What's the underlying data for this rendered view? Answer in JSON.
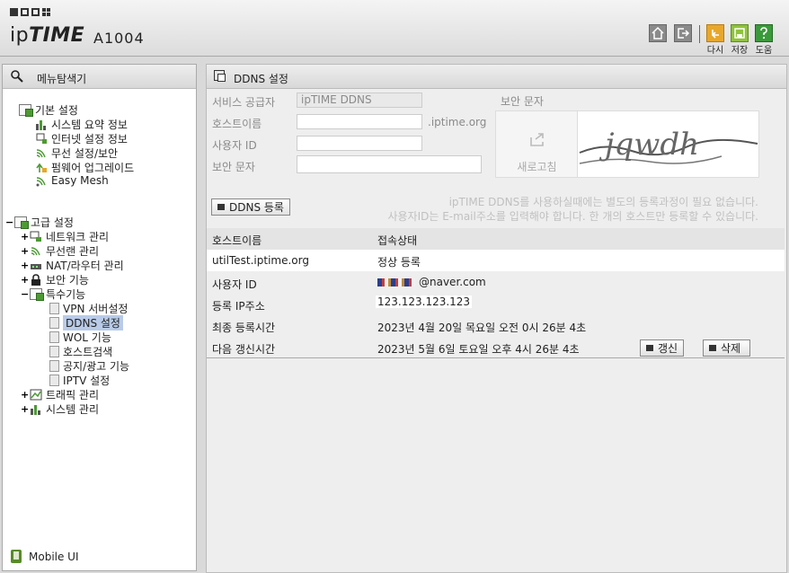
{
  "header": {
    "logo_prefix": "ip",
    "logo_bold": "TIME",
    "model": "A1004",
    "buttons": [
      {
        "name": "home",
        "label": ""
      },
      {
        "name": "logout",
        "label": ""
      },
      {
        "name": "reload",
        "label": "다시"
      },
      {
        "name": "save",
        "label": "저장"
      },
      {
        "name": "help",
        "label": "도움"
      }
    ]
  },
  "sidebar": {
    "title": "메뉴탐색기",
    "groups": [
      {
        "label": "기본 설정",
        "expander": "",
        "items": [
          "시스템 요약 정보",
          "인터넷 설정 정보",
          "무선 설정/보안",
          "펌웨어 업그레이드",
          "Easy Mesh"
        ]
      },
      {
        "label": "고급 설정",
        "expander": "−",
        "items": [
          {
            "label": "네트워크 관리",
            "expander": "+"
          },
          {
            "label": "무선랜 관리",
            "expander": "+"
          },
          {
            "label": "NAT/라우터 관리",
            "expander": "+"
          },
          {
            "label": "보안 기능",
            "expander": "+"
          },
          {
            "label": "특수기능",
            "expander": "−"
          },
          {
            "label": "트래픽 관리",
            "expander": "+"
          },
          {
            "label": "시스템 관리",
            "expander": "+"
          }
        ],
        "special_items": [
          "VPN 서버설정",
          "DDNS 설정",
          "WOL 기능",
          "호스트검색",
          "공지/광고 기능",
          "IPTV 설정"
        ],
        "selected": "DDNS 설정"
      }
    ],
    "mobile_label": "Mobile UI"
  },
  "ddns": {
    "title": "DDNS 설정",
    "labels": {
      "provider": "서비스 공급자",
      "hostname": "호스트이름",
      "userid": "사용자 ID",
      "captcha": "보안 문자",
      "captcha_section": "보안 문자"
    },
    "provider_value": "ipTIME DDNS",
    "hostname_suffix": ".iptime.org",
    "refresh_label": "새로고침",
    "captcha_text": "jqwdh",
    "register_button": "DDNS 등록",
    "note_line1": "ipTIME DDNS를 사용하실때에는 별도의 등록과정이 필요 없습니다.",
    "note_line2": "사용자ID는 E-mail주소를 입력해야 합니다. 한 개의 호스트만 등록할 수 있습니다.",
    "table": {
      "headers": [
        "호스트이름",
        "접속상태"
      ],
      "row": {
        "host": "utilTest.iptime.org",
        "status": "정상 등록"
      }
    },
    "detail": {
      "userid_label": "사용자 ID",
      "userid_value": "@naver.com",
      "ip_label": "등록 IP주소",
      "ip_value": "123.123.123.123",
      "last_label": "최종 등록시간",
      "last_value": "2023년 4월 20일 목요일 오전 0시 26분 4초",
      "next_label": "다음 갱신시간",
      "next_value": "2023년 5월 6일 토요일 오후 4시 26분 4초"
    },
    "renew_button": "갱신",
    "delete_button": "삭제"
  }
}
